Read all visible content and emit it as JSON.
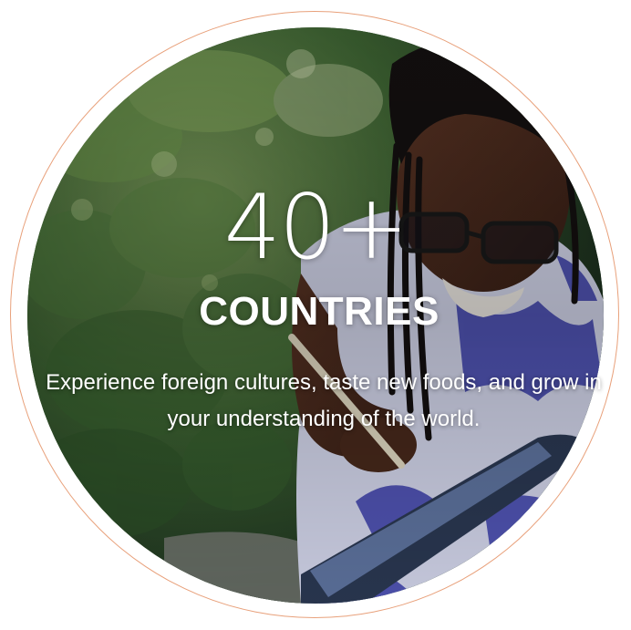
{
  "stat": {
    "number": "40+",
    "label": "COUNTRIES",
    "description": "Experience foreign cultures, taste new foods, and grow in your understanding of the world."
  },
  "colors": {
    "ring": "#e8a07a",
    "text": "#ffffff",
    "foliage": "#3f6b34",
    "dress_blue": "#3b3fb0"
  }
}
